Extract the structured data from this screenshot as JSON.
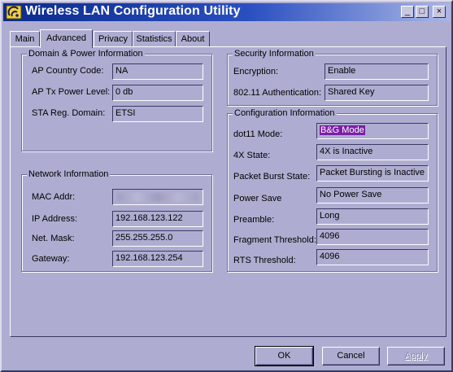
{
  "window": {
    "title": "Wireless LAN Configuration Utility"
  },
  "titlebar_buttons": {
    "minimize": "_",
    "maximize": "□",
    "close": "×"
  },
  "tabs": [
    {
      "label": "Main"
    },
    {
      "label": "Advanced",
      "active": true
    },
    {
      "label": "Privacy"
    },
    {
      "label": "Statistics"
    },
    {
      "label": "About"
    }
  ],
  "domain_power": {
    "title": "Domain & Power Information",
    "ap_country_code": {
      "label": "AP Country Code:",
      "value": "NA"
    },
    "ap_tx_power": {
      "label": "AP Tx Power Level:",
      "value": "0 db"
    },
    "sta_reg_domain": {
      "label": "STA Reg. Domain:",
      "value": "ETSI"
    }
  },
  "network": {
    "title": "Network Information",
    "mac": {
      "label": "MAC Addr:"
    },
    "ip": {
      "label": "IP Address:",
      "value": "192.168.123.122"
    },
    "mask": {
      "label": "Net. Mask:",
      "value": "255.255.255.0"
    },
    "gateway": {
      "label": "Gateway:",
      "value": "192.168.123.254"
    }
  },
  "security": {
    "title": "Security Information",
    "encryption": {
      "label": "Encryption:",
      "value": "Enable"
    },
    "auth": {
      "label": "802.11 Authentication:",
      "value": "Shared Key"
    }
  },
  "config": {
    "title": "Configuration Information",
    "dot11_mode": {
      "label": "dot11 Mode:",
      "value": "B&G Mode"
    },
    "state_4x": {
      "label": "4X State:",
      "value": "4X is Inactive"
    },
    "packet_burst": {
      "label": "Packet Burst State:",
      "value": "Packet Bursting is Inactive"
    },
    "power_save": {
      "label": "Power Save",
      "value": "No Power Save"
    },
    "preamble": {
      "label": "Preamble:",
      "value": "Long"
    },
    "frag_threshold": {
      "label": "Fragment Threshold:",
      "value": "4096"
    },
    "rts_threshold": {
      "label": "RTS Threshold:",
      "value": "4096"
    }
  },
  "buttons": {
    "ok": "OK",
    "cancel": "Cancel",
    "apply": "Apply"
  },
  "colors": {
    "title_start": "#0a2a8c",
    "title_end": "#a9b7e6",
    "face": "#aeadd1",
    "selection": "#7b1fa6"
  },
  "icons": {
    "app": "wireless-app-icon"
  }
}
